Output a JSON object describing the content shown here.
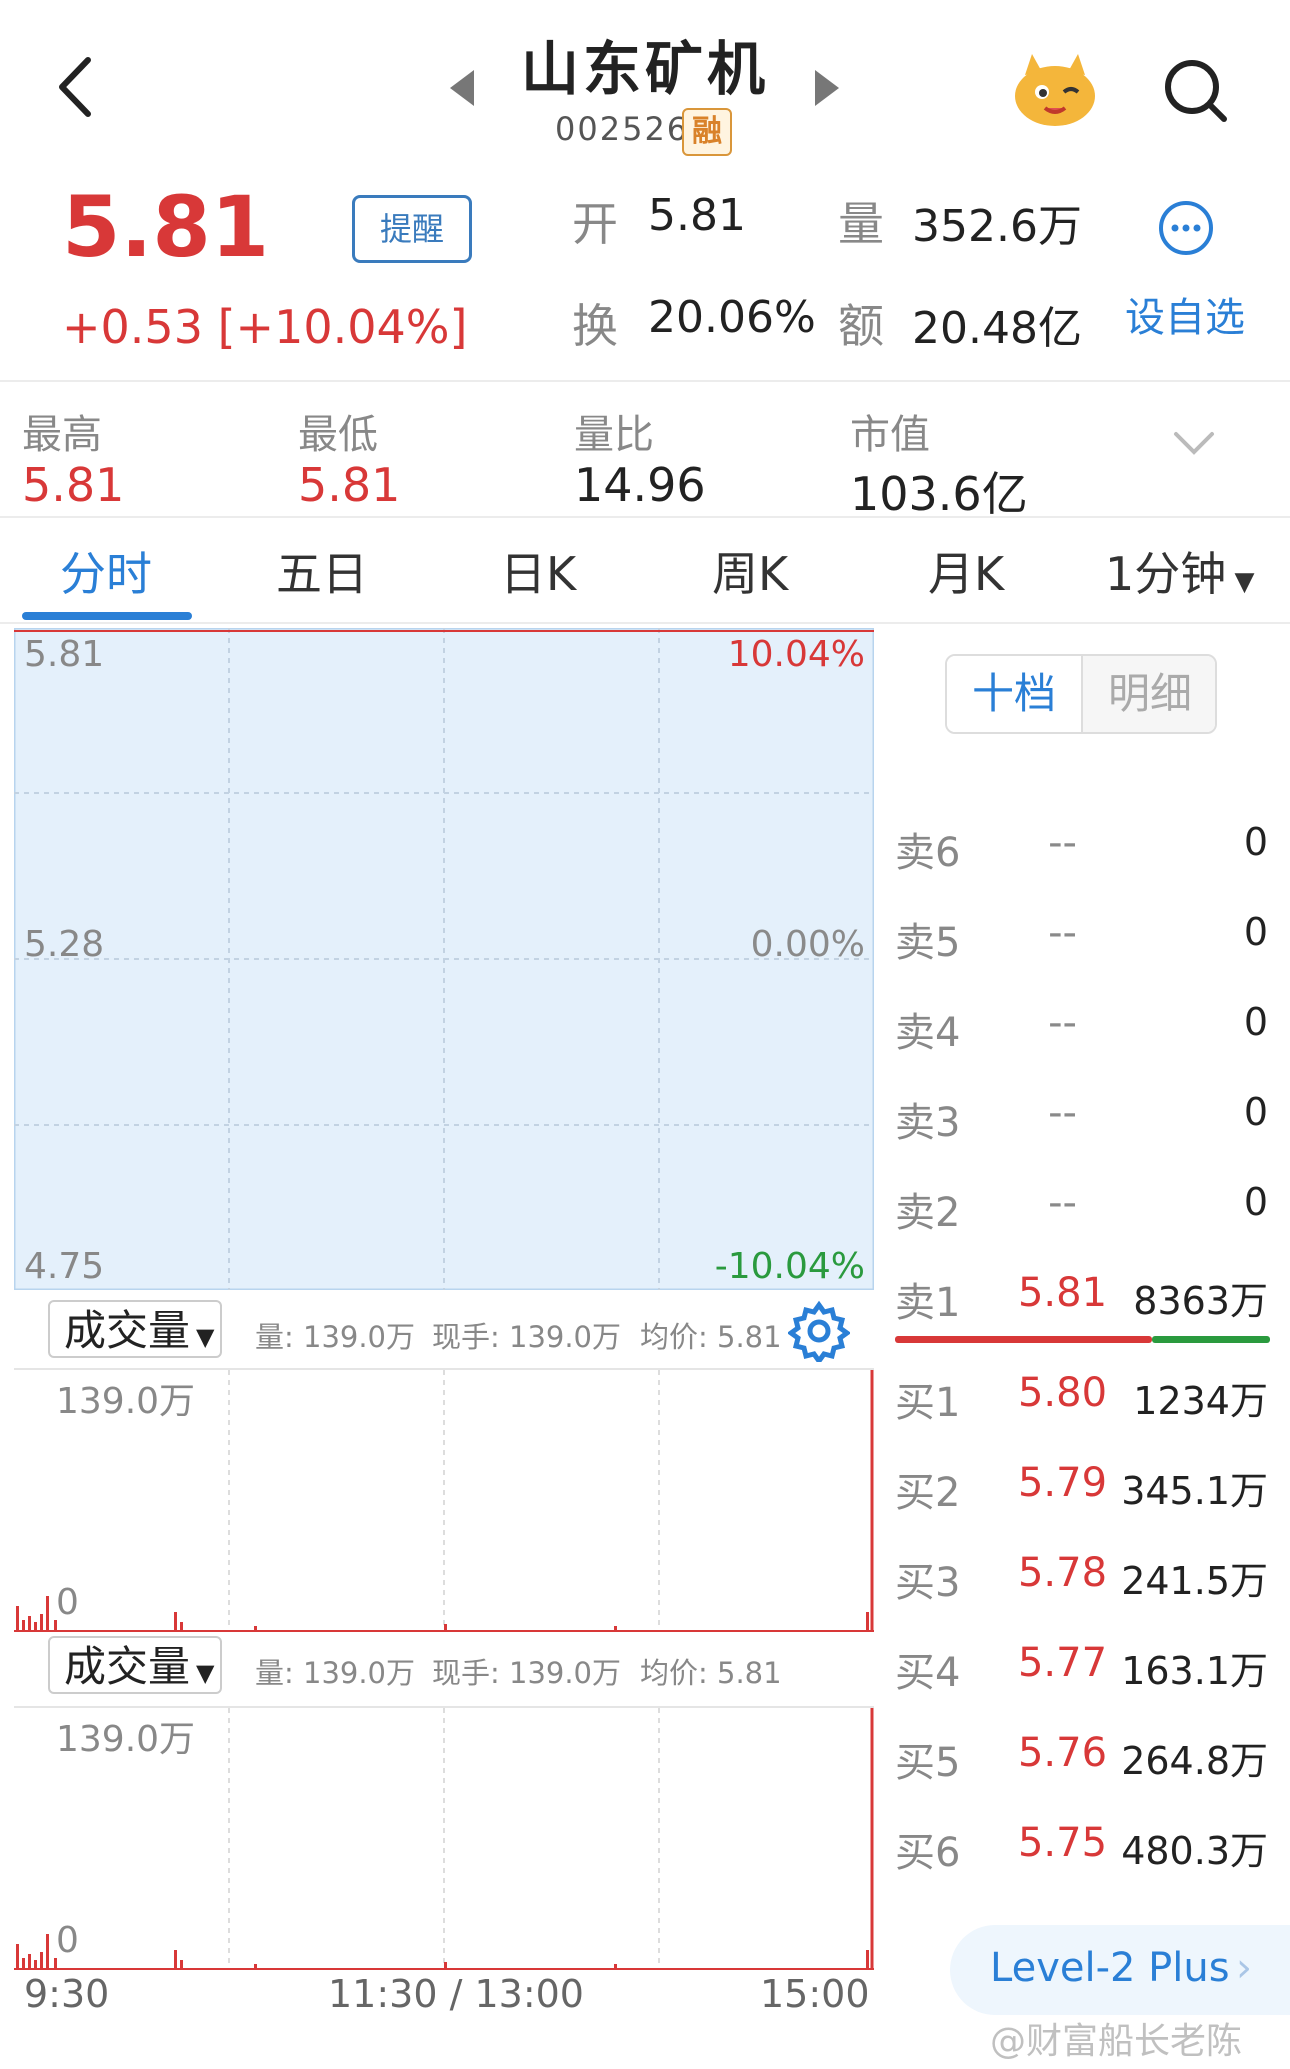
{
  "header": {
    "stock_name": "山东矿机",
    "stock_code": "002526",
    "badge": "融"
  },
  "quote": {
    "price": "5.81",
    "change": "+0.53  [+10.04%]",
    "alert_label": "提醒",
    "open_label": "开",
    "open_value": "5.81",
    "volume_label": "量",
    "volume_value": "352.6万",
    "turnover_label": "换",
    "turnover_value": "20.06%",
    "amount_label": "额",
    "amount_value": "20.48亿",
    "watch_label": "设自选"
  },
  "stats": [
    {
      "label": "最高",
      "value": "5.81"
    },
    {
      "label": "最低",
      "value": "5.81"
    },
    {
      "label": "量比",
      "value": "14.96"
    },
    {
      "label": "市值",
      "value": "103.6亿"
    }
  ],
  "tabs": [
    "分时",
    "五日",
    "日K",
    "周K",
    "月K",
    "1分钟"
  ],
  "chart": {
    "y_top": "5.81",
    "y_mid": "5.28",
    "y_bottom": "4.75",
    "pct_top": "10.04%",
    "pct_mid": "0.00%",
    "pct_bottom": "-10.04%"
  },
  "volume_panels": [
    {
      "select": "成交量",
      "vol": "量: 139.0万",
      "hand": "现手: 139.0万",
      "avg": "均价: 5.81",
      "max": "139.0万",
      "min": "0"
    },
    {
      "select": "成交量",
      "vol": "量: 139.0万",
      "hand": "现手: 139.0万",
      "avg": "均价: 5.81",
      "max": "139.0万",
      "min": "0"
    }
  ],
  "time_axis": {
    "start": "9:30",
    "mid": "11:30 / 13:00",
    "end": "15:00"
  },
  "orderbook": {
    "seg_active": "十档",
    "seg_inactive": "明细",
    "sells": [
      {
        "label": "卖6",
        "price": "--",
        "vol": "0"
      },
      {
        "label": "卖5",
        "price": "--",
        "vol": "0"
      },
      {
        "label": "卖4",
        "price": "--",
        "vol": "0"
      },
      {
        "label": "卖3",
        "price": "--",
        "vol": "0"
      },
      {
        "label": "卖2",
        "price": "--",
        "vol": "0"
      },
      {
        "label": "卖1",
        "price": "5.81",
        "vol": "8363万"
      }
    ],
    "buys": [
      {
        "label": "买1",
        "price": "5.80",
        "vol": "1234万"
      },
      {
        "label": "买2",
        "price": "5.79",
        "vol": "345.1万"
      },
      {
        "label": "买3",
        "price": "5.78",
        "vol": "241.5万"
      },
      {
        "label": "买4",
        "price": "5.77",
        "vol": "163.1万"
      },
      {
        "label": "买5",
        "price": "5.76",
        "vol": "264.8万"
      },
      {
        "label": "买6",
        "price": "5.75",
        "vol": "480.3万"
      }
    ],
    "level2": "Level-2 Plus"
  },
  "watermark": "@财富船长老陈",
  "colors": {
    "up": "#d83838",
    "down": "#2a9a3e",
    "accent": "#2a7fd6"
  }
}
